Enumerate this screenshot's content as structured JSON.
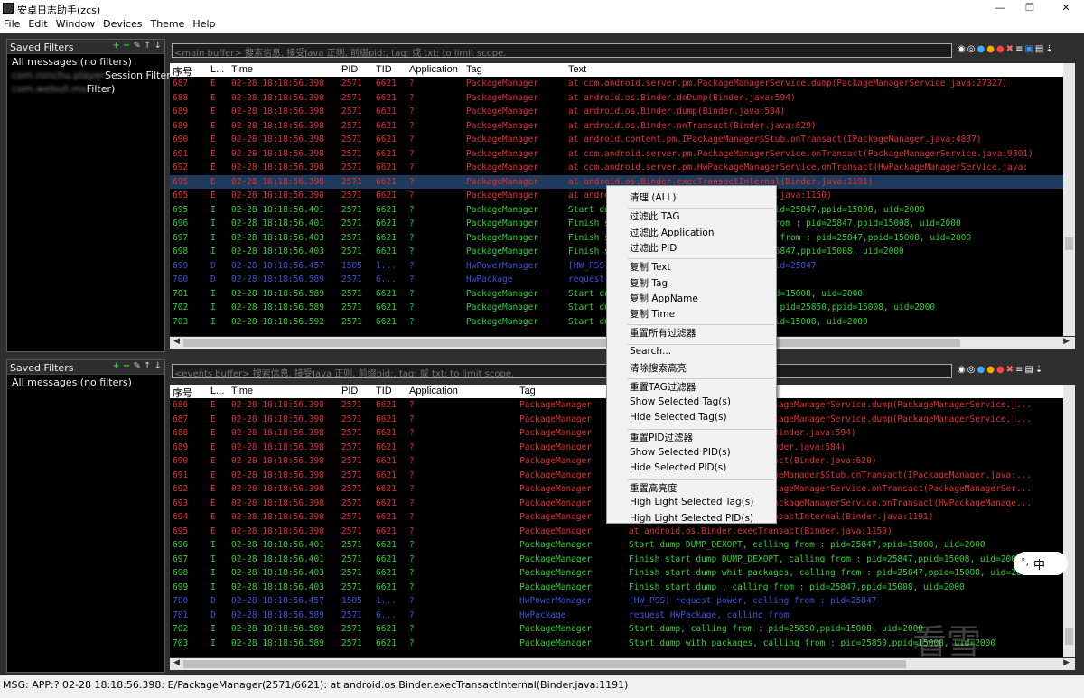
{
  "window": {
    "title": "安卓日志助手(zcs)",
    "minimize": "—",
    "maximize": "❐",
    "close": "✕"
  },
  "menu": [
    "File",
    "Edit",
    "Window",
    "Devices",
    "Theme",
    "Help"
  ],
  "top_pane": {
    "saved_filters_label": "Saved Filters",
    "filters": [
      {
        "label": "All messages (no filters)",
        "blurred_prefix": ""
      },
      {
        "label": "Session Filter)",
        "blurred_prefix": "com.ronchu.player"
      },
      {
        "label": "Filter)",
        "blurred_prefix": "com.webull.ms"
      }
    ],
    "search_placeholder": "<main buffer> 搜索信息, 接受Java 正则, 前缀pid:, tag: 或 txt: to limit scope.",
    "columns": [
      "序号",
      "L...",
      "Time",
      "PID",
      "TID",
      "Application",
      "Tag",
      "Text"
    ],
    "rows": [
      [
        "687",
        "E",
        "02-28 18:18:56.398",
        "2571",
        "6621",
        "?",
        "PackageManager",
        "at com.android.server.pm.PackageManagerService.dump(PackageManagerService.java:27327)"
      ],
      [
        "688",
        "E",
        "02-28 18:18:56.398",
        "2571",
        "6621",
        "?",
        "PackageManager",
        "at android.os.Binder.doDump(Binder.java:594)"
      ],
      [
        "689",
        "E",
        "02-28 18:18:56.398",
        "2571",
        "6621",
        "?",
        "PackageManager",
        "at android.os.Binder.dump(Binder.java:584)"
      ],
      [
        "689",
        "E",
        "02-28 18:18:56.398",
        "2571",
        "6621",
        "?",
        "PackageManager",
        "at android.os.Binder.onTransact(Binder.java:629)"
      ],
      [
        "690",
        "E",
        "02-28 18:18:56.398",
        "2571",
        "6621",
        "?",
        "PackageManager",
        "at android.content.pm.IPackageManager$Stub.onTransact(IPackageManager.java:4837)"
      ],
      [
        "691",
        "E",
        "02-28 18:18:56.398",
        "2571",
        "6621",
        "?",
        "PackageManager",
        "at com.android.server.pm.PackageManagerService.onTransact(PackageManagerService.java:9301)"
      ],
      [
        "692",
        "E",
        "02-28 18:18:56.398",
        "2571",
        "6621",
        "?",
        "PackageManager",
        "at com.android.server.pm.HwPackageManagerService.onTransact(HwPackageManagerService.java:"
      ],
      [
        "695",
        "E",
        "02-28 18:18:56.398",
        "2571",
        "6621",
        "?",
        "PackageManager",
        "at android.os.Binder.execTransactInternal(Binder.java:1191)"
      ],
      [
        "695",
        "E",
        "02-28 18:18:56.398",
        "2571",
        "6621",
        "?",
        "PackageManager",
        "at android.os.Binder.execTransact(Binder.java:1150)"
      ],
      [
        "695",
        "I",
        "02-28 18:18:56.401",
        "2571",
        "6621",
        "?",
        "PackageManager",
        "Start dump DUMP_DEXOPT, calling from : pid=25847,ppid=15008, uid=2000"
      ],
      [
        "696",
        "I",
        "02-28 18:18:56.401",
        "2571",
        "6621",
        "?",
        "PackageManager",
        "Finish start dump DUMP_DEXOPT, calling from : pid=25847,ppid=15008, uid=2000"
      ],
      [
        "697",
        "I",
        "02-28 18:18:56.403",
        "2571",
        "6621",
        "?",
        "PackageManager",
        "Finish start dump whit packages, calling from : pid=25847,ppid=15008, uid=2000"
      ],
      [
        "698",
        "I",
        "02-28 18:18:56.403",
        "2571",
        "6621",
        "?",
        "PackageManager",
        "Finish start dump , calling from : pid=25847,ppid=15008, uid=2000"
      ],
      [
        "699",
        "D",
        "02-28 18:18:56.457",
        "1505",
        "1...",
        "?",
        "HwPowerManager",
        "[HW_PSS] request power, calling from : pid=25847"
      ],
      [
        "700",
        "D",
        "02-28 18:18:56.589",
        "2571",
        "6...",
        "?",
        "HwPackage",
        "request HwPackage, calling from"
      ],
      [
        "701",
        "I",
        "02-28 18:18:56.589",
        "2571",
        "6621",
        "?",
        "PackageManager",
        "Start dump, calling from : pid=25850,ppid=15008, uid=2000"
      ],
      [
        "702",
        "I",
        "02-28 18:18:56.589",
        "2571",
        "6621",
        "?",
        "PackageManager",
        "Start dump with packages, calling from : pid=25850,ppid=15008, uid=2000"
      ],
      [
        "703",
        "I",
        "02-28 18:18:56.592",
        "2571",
        "6621",
        "?",
        "PackageManager",
        "Start dump , calling from : pid=25850,ppid=15008, uid=2000"
      ]
    ]
  },
  "bottom_pane": {
    "saved_filters_label": "Saved Filters",
    "filters": [
      {
        "label": "All messages (no filters)"
      }
    ],
    "search_placeholder": "<events buffer> 搜索信息, 接受Java 正则, 前缀pid:, tag: 或 txt: to limit scope.",
    "columns": [
      "序号",
      "L...",
      "Time",
      "PID",
      "TID",
      "Application",
      "Tag",
      "Text"
    ],
    "rows": [
      [
        "686",
        "E",
        "02-28 18:18:56.398",
        "2571",
        "6621",
        "?",
        "PackageManager",
        "at com.android.server.pm.PackageManagerService.dump(PackageManagerService.j..."
      ],
      [
        "687",
        "E",
        "02-28 18:18:56.398",
        "2571",
        "6621",
        "?",
        "PackageManager",
        "at com.android.server.pm.PackageManagerService.dump(PackageManagerService.j..."
      ],
      [
        "688",
        "E",
        "02-28 18:18:56.398",
        "2571",
        "6621",
        "?",
        "PackageManager",
        "at android.os.Binder.doDump(Binder.java:594)"
      ],
      [
        "689",
        "E",
        "02-28 18:18:56.398",
        "2571",
        "6621",
        "?",
        "PackageManager",
        "at android.os.Binder.dump(Binder.java:584)"
      ],
      [
        "690",
        "E",
        "02-28 18:18:56.398",
        "2571",
        "6621",
        "?",
        "PackageManager",
        "at android.os.Binder.onTransact(Binder.java:620)"
      ],
      [
        "691",
        "E",
        "02-28 18:18:56.398",
        "2571",
        "6621",
        "?",
        "PackageManager",
        "at android.content.pm.IPackageManager$Stub.onTransact(IPackageManager.java:..."
      ],
      [
        "692",
        "E",
        "02-28 18:18:56.398",
        "2571",
        "6621",
        "?",
        "PackageManager",
        "at com.android.server.pm.PackageManagerService.onTransact(PackageManagerSer..."
      ],
      [
        "693",
        "E",
        "02-28 18:18:56.398",
        "2571",
        "6621",
        "?",
        "PackageManager",
        "at com.android.server.pm.HwPackageManagerService.onTransact(HwPackageManage..."
      ],
      [
        "694",
        "E",
        "02-28 18:18:56.398",
        "2571",
        "6621",
        "?",
        "PackageManager",
        "at android.os.Binder.execTransactInternal(Binder.java:1191)"
      ],
      [
        "695",
        "E",
        "02-28 18:18:56.398",
        "2571",
        "6621",
        "?",
        "PackageManager",
        "at android.os.Binder.execTransact(Binder.java:1150)"
      ],
      [
        "696",
        "I",
        "02-28 18:18:56.401",
        "2571",
        "6621",
        "?",
        "PackageManager",
        "Start dump DUMP_DEXOPT, calling from : pid=25847,ppid=15008, uid=2000"
      ],
      [
        "697",
        "I",
        "02-28 18:18:56.401",
        "2571",
        "6621",
        "?",
        "PackageManager",
        "Finish start dump DUMP_DEXOPT, calling from : pid=25847,ppid=15008, uid=2000"
      ],
      [
        "698",
        "I",
        "02-28 18:18:56.403",
        "2571",
        "6621",
        "?",
        "PackageManager",
        "Finish start dump whit packages, calling from : pid=25847,ppid=15008, uid=2000"
      ],
      [
        "699",
        "I",
        "02-28 18:18:56.403",
        "2571",
        "6621",
        "?",
        "PackageManager",
        "Finish start dump , calling from : pid=25847,ppid=15008, uid=2000"
      ],
      [
        "700",
        "D",
        "02-28 18:18:56.457",
        "1505",
        "1...",
        "?",
        "HwPowerManager",
        "[HW_PSS] request power, calling from : pid=25847"
      ],
      [
        "701",
        "D",
        "02-28 18:18:56.589",
        "2571",
        "6...",
        "?",
        "HwPackage",
        "request HwPackage, calling from"
      ],
      [
        "702",
        "I",
        "02-28 18:18:56.589",
        "2571",
        "6621",
        "?",
        "PackageManager",
        "Start dump, calling from : pid=25850,ppid=15008, uid=2000"
      ],
      [
        "703",
        "I",
        "02-28 18:18:56.589",
        "2571",
        "6621",
        "?",
        "PackageManager",
        "Start dump with packages, calling from : pid=25850,ppid=15008, uid=2000"
      ]
    ]
  },
  "context_menu": [
    {
      "label": "清理 (ALL)"
    },
    {
      "sep": true
    },
    {
      "label": "过滤此 TAG"
    },
    {
      "label": "过滤此 Application"
    },
    {
      "label": "过滤此 PID"
    },
    {
      "sep": true
    },
    {
      "label": "复制 Text"
    },
    {
      "label": "复制 Tag"
    },
    {
      "label": "复制 AppName"
    },
    {
      "label": "复制 Time"
    },
    {
      "sep": true
    },
    {
      "label": "重置所有过滤器"
    },
    {
      "sep": true
    },
    {
      "label": "Search..."
    },
    {
      "label": "清除搜索高亮"
    },
    {
      "sep": true
    },
    {
      "label": "重置TAG过滤器"
    },
    {
      "label": "Show Selected Tag(s)"
    },
    {
      "label": "Hide Selected Tag(s)"
    },
    {
      "sep": true
    },
    {
      "label": "重置PID过滤器"
    },
    {
      "label": "Show Selected PID(s)"
    },
    {
      "label": "Hide Selected PID(s)"
    },
    {
      "sep": true
    },
    {
      "label": "重置高亮度"
    },
    {
      "label": "High Light Selected Tag(s)"
    },
    {
      "label": "High Light Selected PID(s)"
    }
  ],
  "status": {
    "text": "MSG: APP:? 02-28 18:18:56.398: E/PackageManager(2571/6621):   at android.os.Binder.execTransactInternal(Binder.java:1191)"
  },
  "ime": {
    "label": "中",
    "dot": "°,"
  },
  "watermark": "看雪",
  "colors": {
    "error": "#e03030",
    "info": "#2fd02f",
    "debug": "#3b53d8",
    "selected": "#1e3a5c"
  },
  "toolbar_icons": [
    "eye-icon",
    "target-icon",
    "info-icon",
    "warn-icon",
    "error-icon",
    "clear-icon",
    "sort-icon",
    "layout-icon",
    "down-icon"
  ]
}
